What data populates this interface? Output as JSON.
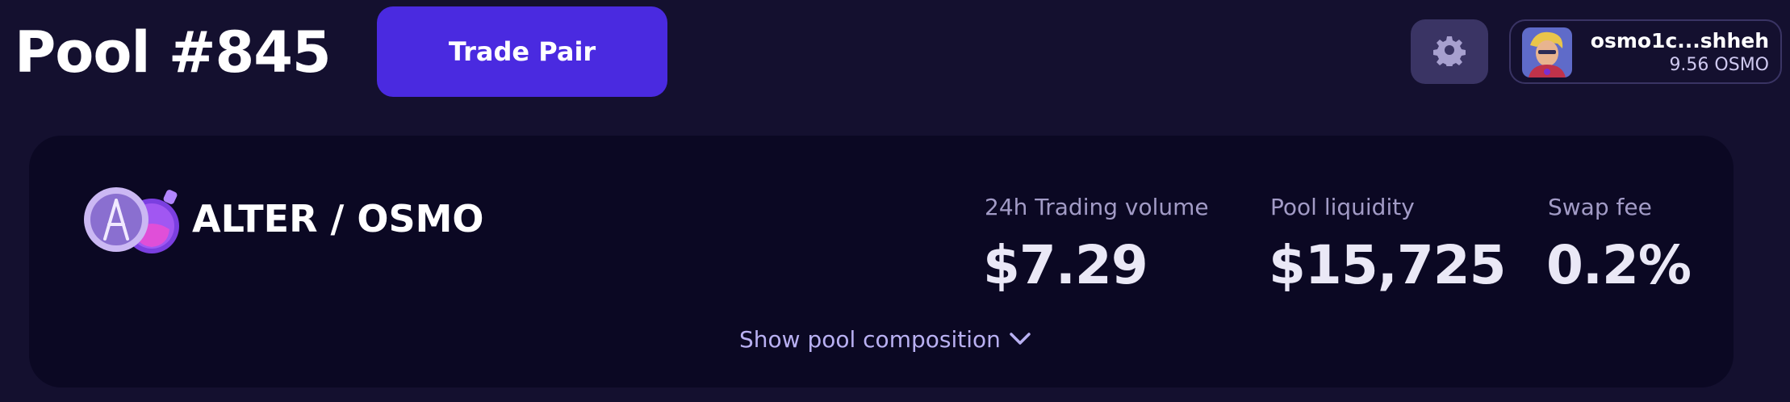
{
  "header": {
    "pool_title": "Pool #845",
    "trade_button_label": "Trade Pair"
  },
  "settings": {
    "icon": "gear-icon"
  },
  "wallet": {
    "address": "osmo1c...shheh",
    "balance": "9.56 OSMO",
    "avatar": "avatar-image"
  },
  "pool_card": {
    "pair": "ALTER / OSMO",
    "stats": [
      {
        "label": "24h Trading volume",
        "value": "$7.29"
      },
      {
        "label": "Pool liquidity",
        "value": "$15,725"
      },
      {
        "label": "Swap fee",
        "value": "0.2%"
      }
    ],
    "show_composition_label": "Show pool composition"
  },
  "colors": {
    "background": "#14102f",
    "card": "#0b0823",
    "accent": "#4a2ae0",
    "muted_label": "#a29bc6",
    "link": "#b9b0f2"
  }
}
